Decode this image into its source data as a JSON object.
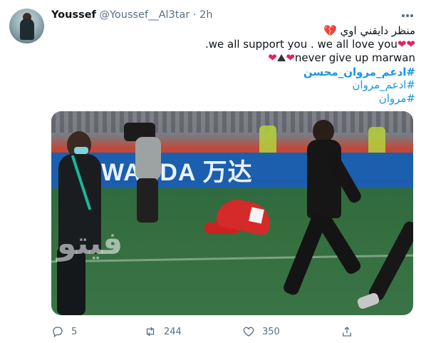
{
  "tweet": {
    "display_name": "Youssef",
    "handle": "@Youssef__Al3tar",
    "separator": " · ",
    "time": "2h",
    "line1_text": "منظر دايقني اوي",
    "line2_text": "we all support you . we all love you.",
    "line3_text": "never give up marwan",
    "hashtag1": "#ادعم_مروان_محسن",
    "hashtag2": "#ادعم_مروان",
    "hashtag3": "#مروان",
    "media": {
      "board_text": "WANDA 万达",
      "watermark": "فيتو"
    }
  },
  "actions": {
    "reply_count": "5",
    "retweet_count": "244",
    "like_count": "350"
  },
  "colors": {
    "link": "#1b95e0",
    "secondary": "#5b7083",
    "heart": "#e0245e"
  },
  "icons": [
    "more-icon",
    "broken-heart-icon",
    "heart-icon",
    "mountain-icon",
    "reply-icon",
    "retweet-icon",
    "like-icon",
    "share-icon"
  ]
}
